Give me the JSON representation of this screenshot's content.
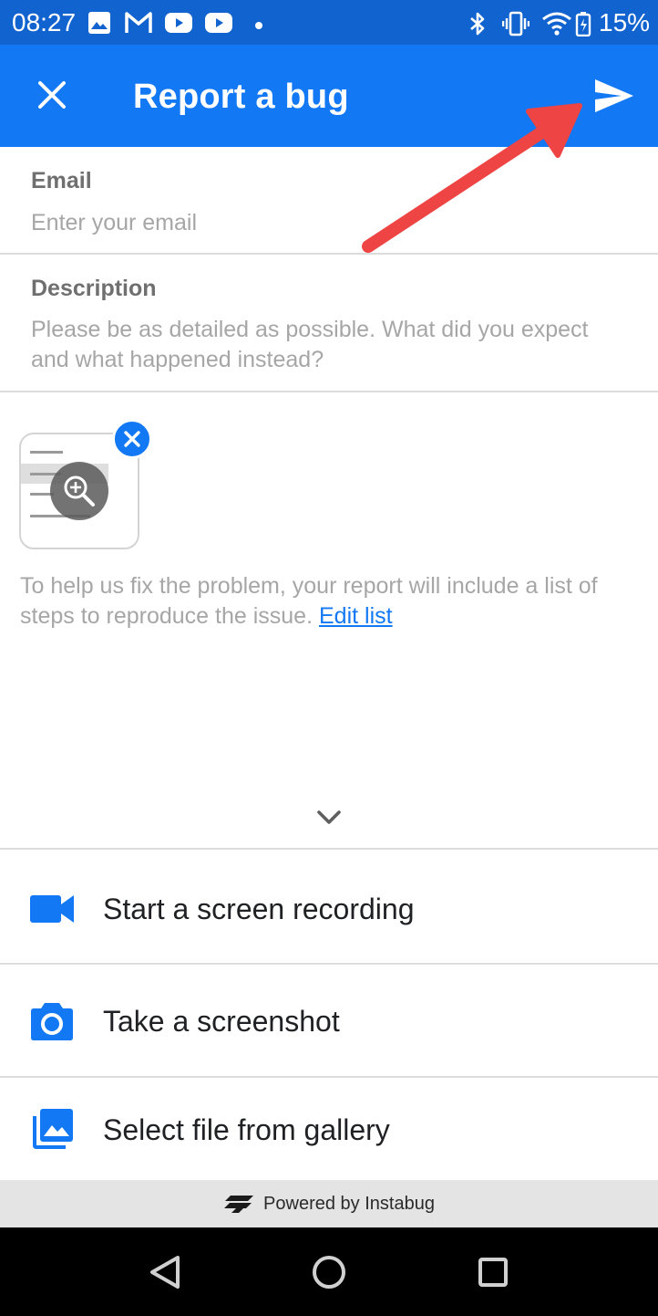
{
  "status_bar": {
    "time": "08:27",
    "battery": "15%",
    "icons": [
      "image-icon",
      "gmail-icon",
      "youtube-icon",
      "youtube-icon",
      "dot-icon",
      "bluetooth-icon",
      "vibrate-icon",
      "wifi-icon",
      "battery-charging-icon"
    ]
  },
  "app_bar": {
    "title": "Report a bug",
    "close_icon": "close-icon",
    "send_icon": "send-icon"
  },
  "form": {
    "email": {
      "label": "Email",
      "placeholder": "Enter your email",
      "value": ""
    },
    "description": {
      "label": "Description",
      "placeholder": "Please be as detailed as possible. What did you expect and what happened instead?",
      "value": ""
    }
  },
  "info": {
    "text": "To help us fix the problem, your report will include a list of steps to reproduce the issue.",
    "link": "Edit list"
  },
  "options": {
    "record": "Start a screen recording",
    "screenshot": "Take a screenshot",
    "gallery": "Select file from gallery"
  },
  "footer": {
    "text": "Powered by Instabug"
  },
  "colors": {
    "primary": "#1278f3",
    "status_bar": "#1163cf",
    "annotation_arrow": "#ee4444",
    "placeholder": "#a6a6a6"
  }
}
